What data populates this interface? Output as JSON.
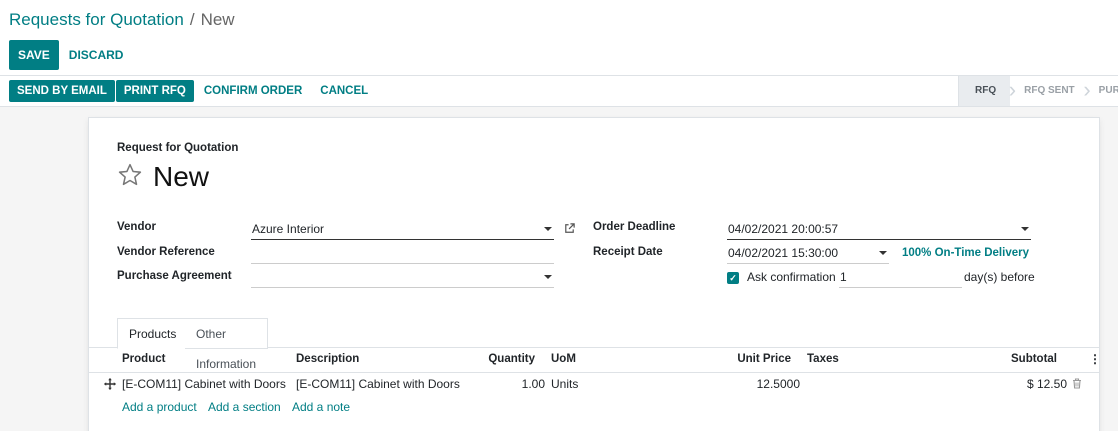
{
  "breadcrumb": {
    "parent": "Requests for Quotation",
    "separator": "/",
    "current": "New"
  },
  "control_panel": {
    "save_label": "SAVE",
    "discard_label": "DISCARD"
  },
  "statusbar": {
    "actions": [
      {
        "label": "SEND BY EMAIL",
        "style": "primary"
      },
      {
        "label": "PRINT RFQ",
        "style": "primary"
      },
      {
        "label": "CONFIRM ORDER",
        "style": "link"
      },
      {
        "label": "CANCEL",
        "style": "link"
      }
    ],
    "stages": [
      {
        "label": "RFQ",
        "active": true
      },
      {
        "label": "RFQ SENT",
        "active": false
      },
      {
        "label": "PURCHASE ORDER",
        "active": false
      }
    ]
  },
  "form": {
    "subtitle": "Request for Quotation",
    "name": "New",
    "favorite_icon": "star-outline-icon",
    "vendor": {
      "label": "Vendor",
      "value": "Azure Interior"
    },
    "vendor_reference": {
      "label": "Vendor Reference",
      "value": ""
    },
    "purchase_agreement": {
      "label": "Purchase Agreement",
      "value": ""
    },
    "order_deadline": {
      "label": "Order Deadline",
      "value": "04/02/2021 20:00:57"
    },
    "receipt_date": {
      "label": "Receipt Date",
      "value": "04/02/2021 15:30:00",
      "on_time": "100% On-Time Delivery"
    },
    "ask_confirmation": {
      "label": "Ask confirmation",
      "checked": true,
      "days": "1",
      "suffix": "day(s) before"
    }
  },
  "tabs": [
    {
      "label": "Products",
      "active": true
    },
    {
      "label": "Other Information",
      "active": false
    }
  ],
  "lines": {
    "columns": {
      "product": "Product",
      "description": "Description",
      "quantity": "Quantity",
      "uom": "UoM",
      "unit_price": "Unit Price",
      "taxes": "Taxes",
      "subtotal": "Subtotal"
    },
    "rows": [
      {
        "product": "[E-COM11] Cabinet with Doors",
        "description": "[E-COM11] Cabinet with Doors",
        "quantity": "1.00",
        "uom": "Units",
        "unit_price": "12.5000",
        "taxes": "",
        "subtotal": "$ 12.50"
      }
    ],
    "add_product": "Add a product",
    "add_section": "Add a section",
    "add_note": "Add a note"
  },
  "colors": {
    "primary": "#017e84",
    "text": "#212529",
    "border": "#dee2e6"
  }
}
